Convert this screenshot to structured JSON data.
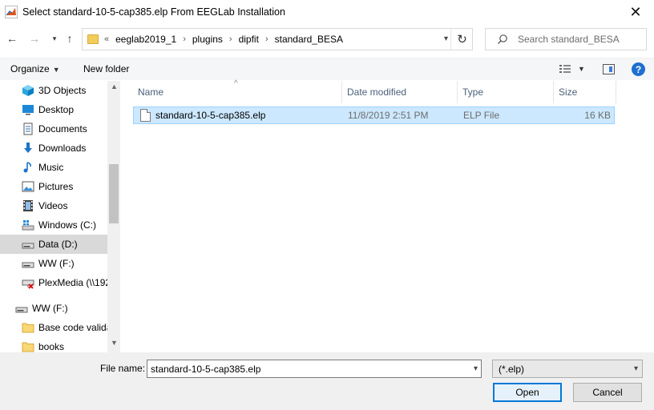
{
  "window": {
    "title": "Select standard-10-5-cap385.elp From EEGLab Installation",
    "close_icon": "close-icon"
  },
  "nav": {
    "back_icon": "back-arrow-icon",
    "forward_icon": "forward-arrow-icon",
    "recent_icon": "chevron-down-icon",
    "up_icon": "up-arrow-icon",
    "breadcrumb_overflow": "«",
    "breadcrumbs": [
      "eeglab2019_1",
      "plugins",
      "dipfit",
      "standard_BESA"
    ],
    "refresh_icon": "refresh-icon",
    "search_placeholder": "Search standard_BESA"
  },
  "toolbar": {
    "organize_label": "Organize",
    "new_folder_label": "New folder",
    "view_icon": "view-options-icon",
    "preview_pane_icon": "preview-pane-icon",
    "help_label": "?"
  },
  "sidebar": {
    "items": [
      {
        "label": "3D Objects",
        "icon": "3d-objects-icon"
      },
      {
        "label": "Desktop",
        "icon": "desktop-icon"
      },
      {
        "label": "Documents",
        "icon": "documents-icon"
      },
      {
        "label": "Downloads",
        "icon": "downloads-icon"
      },
      {
        "label": "Music",
        "icon": "music-icon"
      },
      {
        "label": "Pictures",
        "icon": "pictures-icon"
      },
      {
        "label": "Videos",
        "icon": "videos-icon"
      },
      {
        "label": "Windows (C:)",
        "icon": "windows-drive-icon"
      },
      {
        "label": "Data (D:)",
        "icon": "drive-icon",
        "selected": true
      },
      {
        "label": "WW (F:)",
        "icon": "drive-icon"
      },
      {
        "label": "PlexMedia (\\\\192",
        "icon": "network-drive-disconnected-icon"
      },
      {
        "label": "WW (F:)",
        "icon": "drive-icon",
        "root": true
      },
      {
        "label": "Base code valida",
        "icon": "folder-icon"
      },
      {
        "label": "books",
        "icon": "folder-icon"
      }
    ]
  },
  "filelist": {
    "columns": {
      "name": "Name",
      "date": "Date modified",
      "type": "Type",
      "size": "Size"
    },
    "files": [
      {
        "name": "standard-10-5-cap385.elp",
        "date": "11/8/2019 2:51 PM",
        "type": "ELP File",
        "size": "16 KB",
        "selected": true
      }
    ]
  },
  "footer": {
    "file_name_label": "File name:",
    "file_name_value": "standard-10-5-cap385.elp",
    "filter_value": "(*.elp)",
    "open_label": "Open",
    "cancel_label": "Cancel"
  },
  "colors": {
    "selection_bg": "#cce8ff",
    "selection_border": "#99d1ff",
    "accent": "#0078d7",
    "header_text": "#4c607a"
  }
}
